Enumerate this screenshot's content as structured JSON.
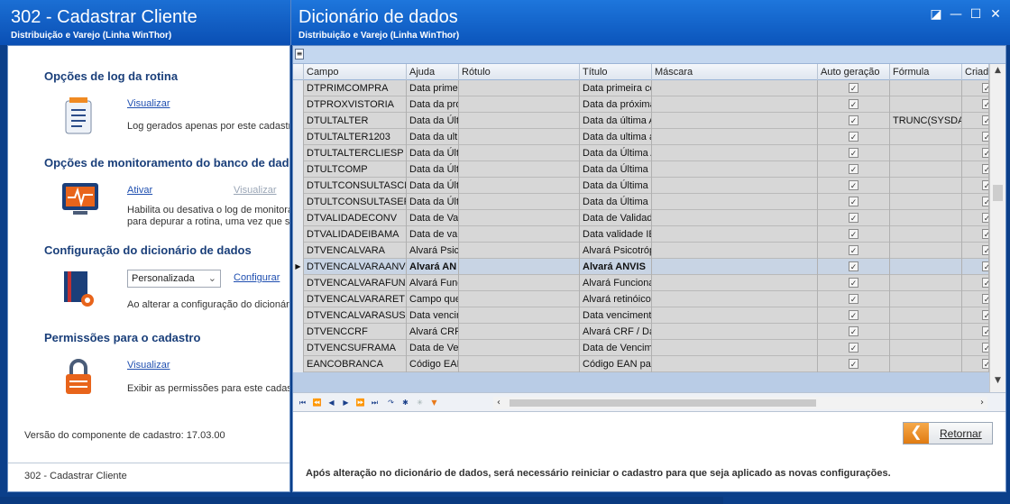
{
  "left_window": {
    "title": "302 - Cadastrar Cliente",
    "subtitle": "Distribuição e Varejo (Linha WinThor)",
    "sections": {
      "log": {
        "title": "Opções de log da rotina",
        "link": "Visualizar",
        "desc": "Log gerados apenas por este cadastro"
      },
      "monitor": {
        "title": "Opções de monitoramento do banco de dados",
        "link1": "Ativar",
        "link2": "Visualizar",
        "desc1": "Habilita ou desativa o log de monitoramento",
        "desc2": "para depurar a rotina, uma vez que se"
      },
      "dict": {
        "title": "Configuração do dicionário de dados",
        "select_value": "Personalizada",
        "link": "Configurar",
        "desc": "Ao alterar a configuração do dicionário"
      },
      "perm": {
        "title": "Permissões para o cadastro",
        "link": "Visualizar",
        "desc": "Exibir as permissões para este cadastro"
      }
    },
    "version": "Versão do componente de cadastro: 17.03.00",
    "status": "302 - Cadastrar Cliente"
  },
  "right_window": {
    "title": "Dicionário de dados",
    "subtitle": "Distribuição e Varejo (Linha WinThor)",
    "buttons": {
      "restore": "◪",
      "minimize": "—",
      "maximize": "☐",
      "close": "✕"
    }
  },
  "grid": {
    "columns": [
      "Campo",
      "Ajuda",
      "Rótulo",
      "Título",
      "Máscara",
      "Auto geração",
      "Fórmula",
      "Criado"
    ],
    "rows": [
      {
        "campo": "DTPRIMCOMPRA",
        "ajuda": "Data primei",
        "rotulo": "",
        "titulo": "Data primeira co",
        "mascara": "",
        "auto": true,
        "formula": ""
      },
      {
        "campo": "DTPROXVISTORIA",
        "ajuda": "Data da pró",
        "rotulo": "",
        "titulo": "Data da próxima",
        "mascara": "",
        "auto": true,
        "formula": ""
      },
      {
        "campo": "DTULTALTER",
        "ajuda": "Data da Últ",
        "rotulo": "",
        "titulo": "Data da última A",
        "mascara": "",
        "auto": true,
        "formula": "TRUNC(SYSDAT"
      },
      {
        "campo": "DTULTALTER1203",
        "ajuda": "Data da ulti",
        "rotulo": "",
        "titulo": "Data da ultima a",
        "mascara": "",
        "auto": true,
        "formula": ""
      },
      {
        "campo": "DTULTALTERCLIESP",
        "ajuda": "Data da Últ",
        "rotulo": "",
        "titulo": "Data da Última A",
        "mascara": "",
        "auto": true,
        "formula": ""
      },
      {
        "campo": "DTULTCOMP",
        "ajuda": "Data da Últ",
        "rotulo": "",
        "titulo": "Data da Última C",
        "mascara": "",
        "auto": true,
        "formula": ""
      },
      {
        "campo": "DTULTCONSULTASCI",
        "ajuda": "Data da Últ",
        "rotulo": "",
        "titulo": "Data da Última C",
        "mascara": "",
        "auto": true,
        "formula": ""
      },
      {
        "campo": "DTULTCONSULTASERA",
        "ajuda": "Data da Últ",
        "rotulo": "",
        "titulo": "Data da Última C",
        "mascara": "",
        "auto": true,
        "formula": ""
      },
      {
        "campo": "DTVALIDADECONV",
        "ajuda": "Data de Val",
        "rotulo": "",
        "titulo": "Data de Validad",
        "mascara": "",
        "auto": true,
        "formula": ""
      },
      {
        "campo": "DTVALIDADEIBAMA",
        "ajuda": "Data de val",
        "rotulo": "",
        "titulo": "Data validade IE",
        "mascara": "",
        "auto": true,
        "formula": ""
      },
      {
        "campo": "DTVENCALVARA",
        "ajuda": "Alvará Psic",
        "rotulo": "",
        "titulo": "Alvará Psicotróp",
        "mascara": "",
        "auto": true,
        "formula": ""
      },
      {
        "campo": "DTVENCALVARAANVIS",
        "ajuda": "Alvará AN",
        "rotulo": "",
        "titulo": "Alvará ANVIS",
        "mascara": "",
        "auto": true,
        "formula": "",
        "current": true
      },
      {
        "campo": "DTVENCALVARAFUNC",
        "ajuda": "Alvará Func",
        "rotulo": "",
        "titulo": "Alvará Funciona",
        "mascara": "",
        "auto": true,
        "formula": ""
      },
      {
        "campo": "DTVENCALVARARETINO",
        "ajuda": "Campo que",
        "rotulo": "",
        "titulo": "Alvará retinóico",
        "mascara": "",
        "auto": true,
        "formula": ""
      },
      {
        "campo": "DTVENCALVARASUS",
        "ajuda": "Data vencir",
        "rotulo": "",
        "titulo": "Data venciment",
        "mascara": "",
        "auto": true,
        "formula": ""
      },
      {
        "campo": "DTVENCCRF",
        "ajuda": "Alvará CRF",
        "rotulo": "",
        "titulo": "Alvará CRF / Da",
        "mascara": "",
        "auto": true,
        "formula": ""
      },
      {
        "campo": "DTVENCSUFRAMA",
        "ajuda": "Data de Ver",
        "rotulo": "",
        "titulo": "Data de Vencim",
        "mascara": "",
        "auto": true,
        "formula": ""
      },
      {
        "campo": "EANCOBRANCA",
        "ajuda": "Código EAN",
        "rotulo": "",
        "titulo": "Código EAN par",
        "mascara": "",
        "auto": true,
        "formula": ""
      }
    ]
  },
  "return_button": "Retornar",
  "footer_note": "Após alteração no dicionário de dados, será necessário reiniciar o cadastro para que seja aplicado as novas configurações."
}
